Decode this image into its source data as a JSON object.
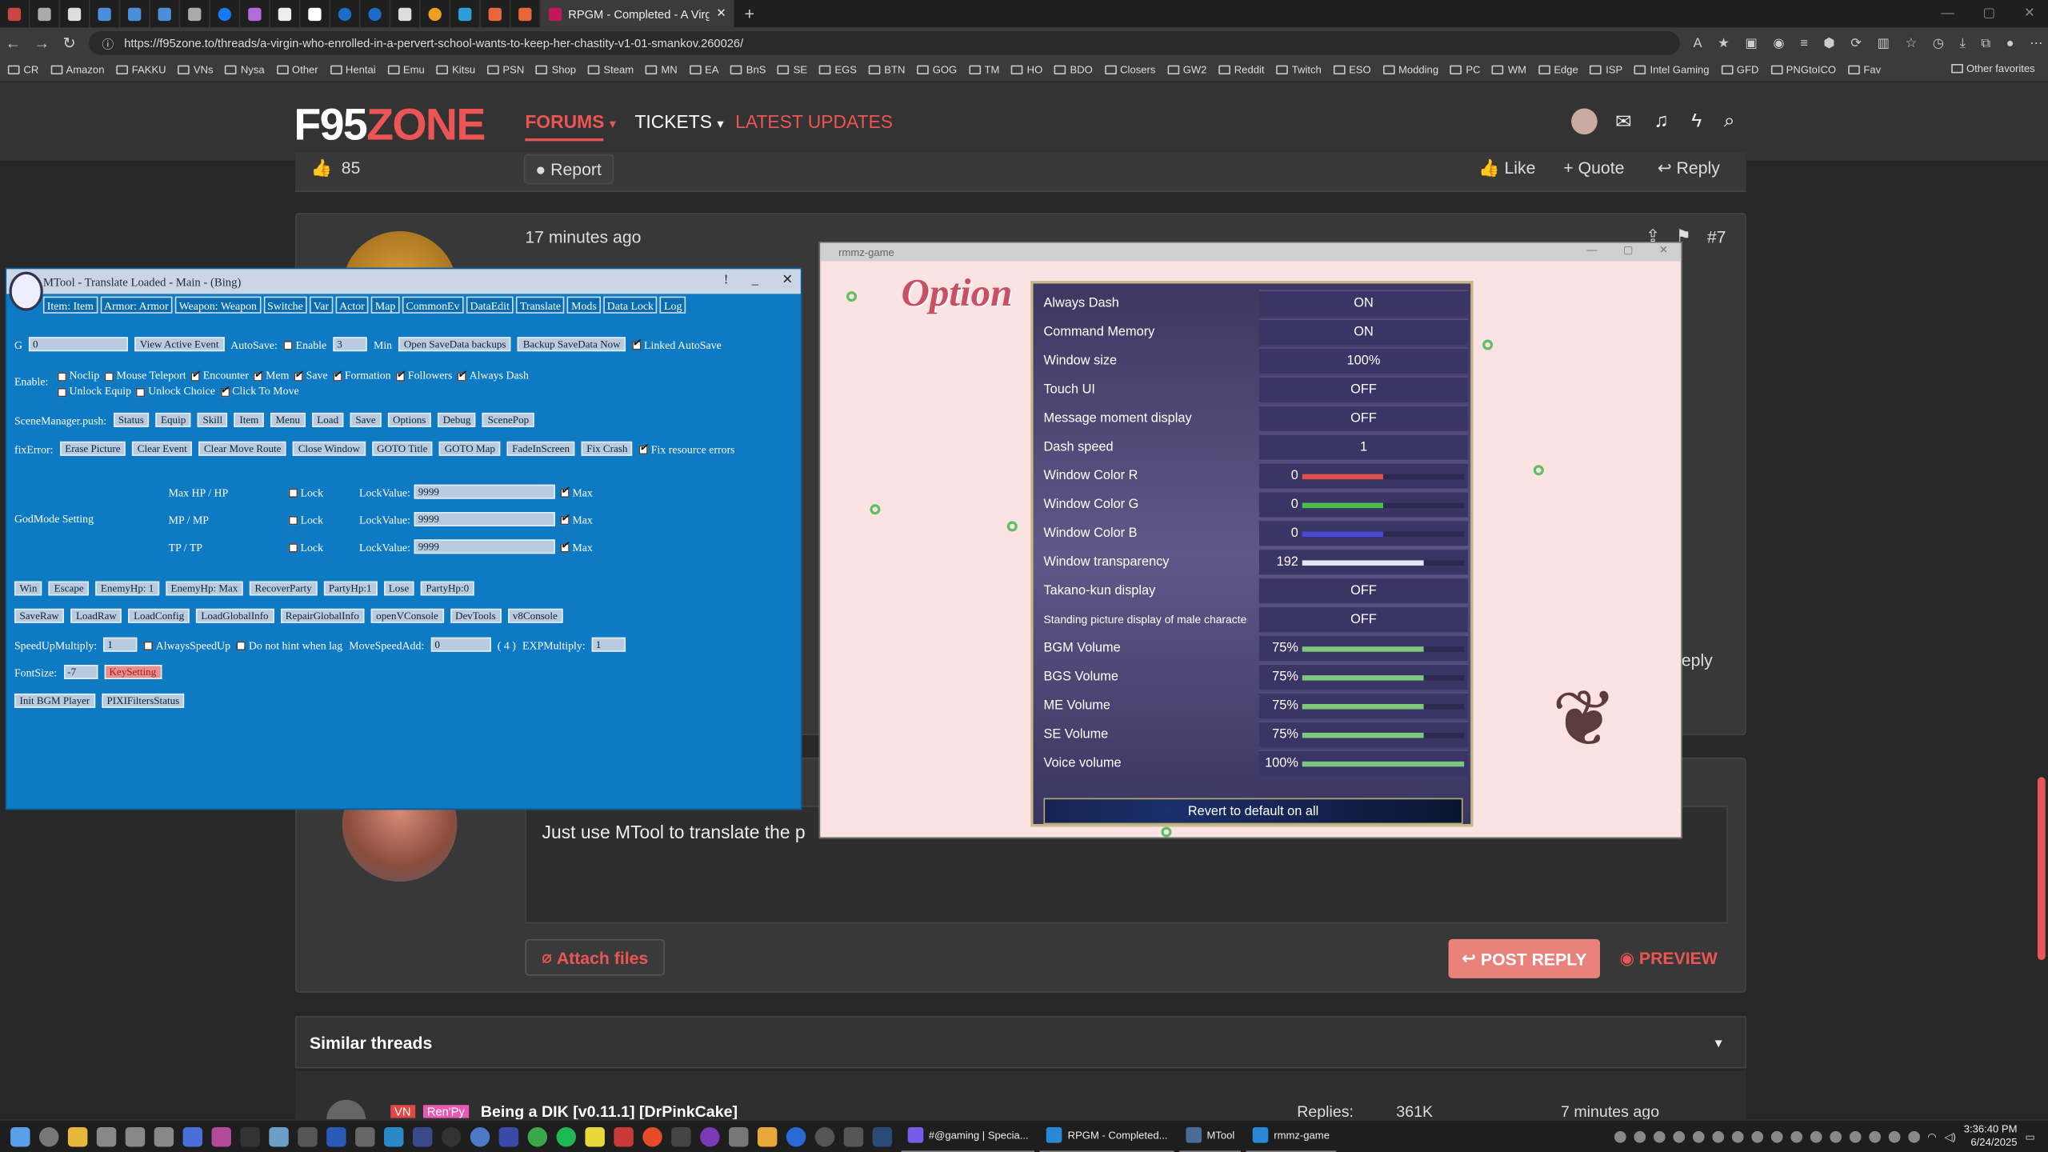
{
  "browser": {
    "active_tab_title": "RPGM - Completed - A Virgin Wh",
    "url": "https://f95zone.to/threads/a-virgin-who-enrolled-in-a-pervert-school-wants-to-keep-her-chastity-v1-01-smankov.260026/",
    "bookmarks": [
      "CR",
      "Amazon",
      "FAKKU",
      "VNs",
      "Nysa",
      "Other",
      "Hentai",
      "Emu",
      "Kitsu",
      "PSN",
      "Shop",
      "Steam",
      "MN",
      "EA",
      "BnS",
      "SE",
      "EGS",
      "BTN",
      "GOG",
      "TM",
      "HO",
      "BDO",
      "Closers",
      "GW2",
      "Reddit",
      "Twitch",
      "ESO",
      "Modding",
      "PC",
      "WM",
      "Edge",
      "ISP",
      "Intel Gaming",
      "GFD",
      "PNGtoICO",
      "Fav"
    ],
    "other_favorites": "Other favorites"
  },
  "site": {
    "logo_a": "F95",
    "logo_b": "ZONE",
    "nav": {
      "forums": "FORUMS",
      "tickets": "TICKETS",
      "latest": "LATEST UPDATES"
    },
    "likes_count": "85",
    "report": "Report",
    "like": "Like",
    "quote": "Quote",
    "reply": "Reply",
    "time_ago": "17 minutes ago",
    "post_number": "#7",
    "reply_text": "Just use MTool to translate the p",
    "attach_files": "Attach files",
    "post_reply": "POST REPLY",
    "preview": "PREVIEW",
    "similar_threads": "Similar threads",
    "similar": {
      "badge1": "VN",
      "badge2": "Ren'Py",
      "name": "Being a DIK [v0.11.1] [DrPinkCake]",
      "replies_label": "Replies:",
      "replies_count": "361K",
      "time": "7 minutes ago"
    }
  },
  "mtool": {
    "title": "MTool - Translate Loaded - Main - (Bing)",
    "tabs": [
      "Item: Item",
      "Armor: Armor",
      "Weapon: Weapon",
      "Switche",
      "Var",
      "Actor",
      "Map",
      "CommonEv",
      "DataEdit",
      "Translate",
      "Mods",
      "Data Lock",
      "Log"
    ],
    "g_label": "G",
    "g_value": "0",
    "view_active_event": "View Active Event",
    "autosave": "AutoSave:",
    "enable": "Enable",
    "minutes": "3",
    "min": "Min",
    "open_backups": "Open SaveData backups",
    "backup_now": "Backup SaveData Now",
    "linked_autosave": "Linked AutoSave",
    "enable_label": "Enable:",
    "enable_row1": [
      "Noclip",
      "Mouse Teleport",
      "Encounter",
      "Mem",
      "Save",
      "Formation",
      "Followers",
      "Always Dash"
    ],
    "enable_row2": [
      "Unlock Equip",
      "Unlock Choice",
      "Click To Move"
    ],
    "scene_label": "SceneManager.push:",
    "scene_buttons": [
      "Status",
      "Equip",
      "Skill",
      "Item",
      "Menu",
      "Load",
      "Save",
      "Options",
      "Debug",
      "ScenePop"
    ],
    "fix_label": "fixError:",
    "fix_buttons": [
      "Erase Picture",
      "Clear Event",
      "Clear Move Route",
      "Close Window",
      "GOTO Title",
      "GOTO Map",
      "FadeInScreen",
      "Fix Crash"
    ],
    "fix_resource": "Fix resource errors",
    "godmode": "GodMode Setting",
    "god_rows": [
      {
        "label": "Max HP / HP",
        "lock": "Lock",
        "lockvalue": "LockValue:",
        "value": "9999",
        "max": "Max"
      },
      {
        "label": "MP / MP",
        "lock": "Lock",
        "lockvalue": "LockValue:",
        "value": "9999",
        "max": "Max"
      },
      {
        "label": "TP / TP",
        "lock": "Lock",
        "lockvalue": "LockValue:",
        "value": "9999",
        "max": "Max"
      }
    ],
    "row_a": [
      "Win",
      "Escape",
      "EnemyHp: 1",
      "EnemyHp: Max",
      "RecoverParty",
      "PartyHp:1",
      "Lose",
      "PartyHp:0"
    ],
    "row_b": [
      "SaveRaw",
      "LoadRaw",
      "LoadConfig",
      "LoadGlobalInfo",
      "RepairGlobalInfo",
      "openVConsole",
      "DevTools",
      "v8Console"
    ],
    "speedup": "SpeedUpMultiply:",
    "speedup_value": "1",
    "always_speedup": "AlwaysSpeedUp",
    "no_hint": "Do not hint when lag",
    "move_speed": "MoveSpeedAdd:",
    "move_speed_value": "0",
    "four": "( 4 )",
    "exp": "EXPMultiply:",
    "exp_value": "1",
    "fontsize": "FontSize:",
    "fontsize_value": "-7",
    "keysetting": "KeySetting",
    "init_bgm": "Init BGM Player",
    "pixi": "PIXIFiltersStatus"
  },
  "game": {
    "title": "rmmz-game",
    "heading": "Option",
    "options": [
      {
        "name": "Always Dash",
        "value": "ON"
      },
      {
        "name": "Command Memory",
        "value": "ON"
      },
      {
        "name": "Window size",
        "value": "100%"
      },
      {
        "name": "Touch UI",
        "value": "OFF"
      },
      {
        "name": "Message moment display",
        "value": "OFF"
      },
      {
        "name": "Dash speed",
        "value": "1"
      },
      {
        "name": "Window Color R",
        "num": "0",
        "level": 0.5,
        "color": "#e0504a"
      },
      {
        "name": "Window Color G",
        "num": "0",
        "level": 0.5,
        "color": "#4ec04a"
      },
      {
        "name": "Window Color B",
        "num": "0",
        "level": 0.5,
        "color": "#4848d8"
      },
      {
        "name": "Window transparency",
        "num": "192",
        "level": 0.75,
        "color": "#e8e8f0"
      },
      {
        "name": "Takano-kun display",
        "value": "OFF"
      },
      {
        "name": "Standing picture display of male characters",
        "value": "OFF"
      },
      {
        "name": "BGM Volume",
        "num": "75%",
        "level": 0.75,
        "color": "#7cc87c"
      },
      {
        "name": "BGS Volume",
        "num": "75%",
        "level": 0.75,
        "color": "#7cc87c"
      },
      {
        "name": "ME Volume",
        "num": "75%",
        "level": 0.75,
        "color": "#7cc87c"
      },
      {
        "name": "SE Volume",
        "num": "75%",
        "level": 0.75,
        "color": "#7cc87c"
      },
      {
        "name": "Voice volume",
        "num": "100%",
        "level": 1.0,
        "color": "#7cc87c"
      }
    ],
    "revert": "Revert to default on all"
  },
  "taskbar": {
    "apps": [
      {
        "label": "#@gaming | Specia..."
      },
      {
        "label": "RPGM - Completed..."
      },
      {
        "label": "MTool"
      },
      {
        "label": "rmmz-game"
      }
    ],
    "time": "3:36:40 PM",
    "date": "6/24/2025"
  }
}
